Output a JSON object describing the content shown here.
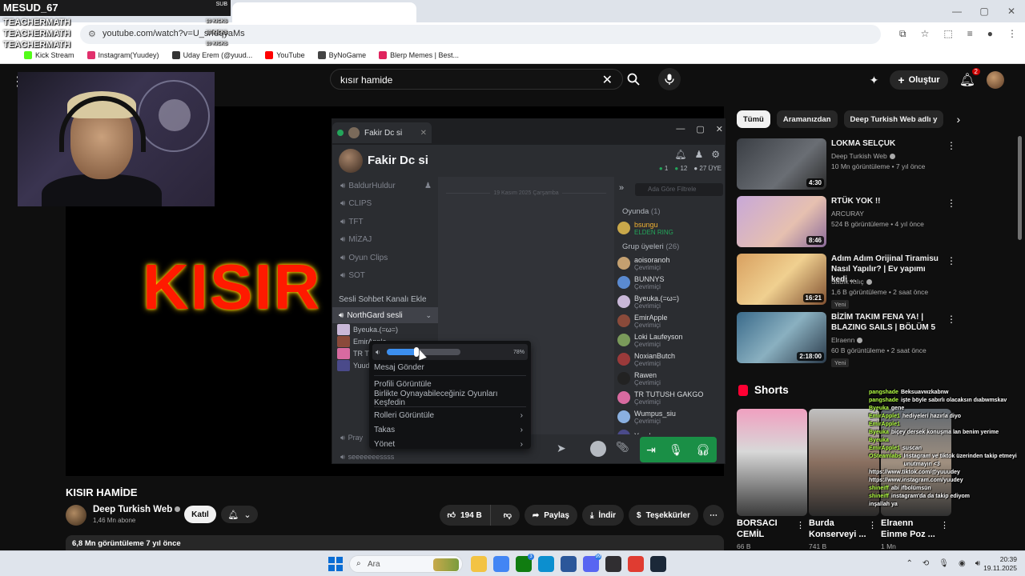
{
  "obs": {
    "username": "MESUD_67",
    "sub_label": "SUB",
    "lines": [
      {
        "text": "TEACHERMATH",
        "small": "10 KICKS"
      },
      {
        "text": "TEACHERMATH",
        "small": "10 KICKS"
      },
      {
        "text": "TEACHERMATH",
        "small": "10 KICKS"
      }
    ]
  },
  "browser": {
    "url": "youtube.com/watch?v=U_srfdqyaMs",
    "bookmarks": [
      {
        "label": "Kick Stream",
        "color": "#53fc18"
      },
      {
        "label": "Instagram(Yuudey)",
        "color": "#e1306c"
      },
      {
        "label": "Uday Erem (@yuud...",
        "color": "#333333"
      },
      {
        "label": "YouTube",
        "color": "#ff0000"
      },
      {
        "label": "ByNoGame",
        "color": "#444444"
      },
      {
        "label": "Blerp Memes | Best...",
        "color": "#e0245e"
      }
    ]
  },
  "youtube": {
    "search_query": "kısır hamide",
    "create_label": "Oluştur",
    "notif_count": "2",
    "video_overlay_text": "KISIR",
    "video_title": "KISIR HAMİDE",
    "channel_name": "Deep Turkish Web",
    "subscribers": "1,46 Mn abone",
    "join_label": "Katıl",
    "likes": "194 B",
    "share_label": "Paylaş",
    "download_label": "İndir",
    "thanks_label": "Teşekkürler",
    "desc_stats": "6,8 Mn görüntüleme  7 yıl önce",
    "chips": [
      "Tümü",
      "Aramanızdan",
      "Deep Turkish Web adlı y"
    ],
    "recommendations": [
      {
        "title": "LOKMA SELÇUK",
        "channel": "Deep Turkish Web",
        "meta": "10 Mn görüntüleme • 7 yıl önce",
        "duration": "4:30",
        "verified": true,
        "badge": ""
      },
      {
        "title": "RTÜK YOK !!",
        "channel": "ARCURAY",
        "meta": "524 B görüntüleme • 4 yıl önce",
        "duration": "8:46",
        "verified": false,
        "badge": ""
      },
      {
        "title": "Adım Adım Orijinal Tiramisu Nasıl Yapılır? | Ev yapımı kedi ...",
        "channel": "Sadık Kılıç",
        "meta": "1,6 B görüntüleme • 2 saat önce",
        "duration": "16:21",
        "verified": true,
        "badge": "Yeni"
      },
      {
        "title": "BİZİM TAKIM FENA YA! | BLAZING SAILS | BÖLÜM 5",
        "channel": "Elraenn",
        "meta": "60 B görüntüleme • 2 saat önce",
        "duration": "2:18:00",
        "verified": true,
        "badge": "Yeni"
      }
    ],
    "shorts_heading": "Shorts",
    "shorts": [
      {
        "title": "BORSACI CEMİL",
        "views": "66 B"
      },
      {
        "title": "Burda Konserveyi ...",
        "views": "741 B"
      },
      {
        "title": "Elraenn Einme Poz ...",
        "views": "1 Mn"
      }
    ]
  },
  "discord": {
    "tab_title": "Fakir Dc si",
    "server_name": "Fakir Dc si",
    "stats": {
      "online": "1",
      "members_online": "12",
      "members": "27 ÜYE"
    },
    "channels": [
      "BaldurHuldur",
      "CLIPS",
      "TFT",
      "MİZAJ",
      "Oyun Clips",
      "SOT"
    ],
    "add_voice_label": "Sesli Sohbet Kanalı Ekle",
    "voice_channel": "NorthGard sesli",
    "voice_users": [
      {
        "name": "Byeuka.(=ω=)",
        "color": "#c9b8d8"
      },
      {
        "name": "EmirApple",
        "color": "#8a4a3a"
      },
      {
        "name": "TR TUTUSH GAKGO",
        "color": "#d86aa0"
      },
      {
        "name": "Yuudey",
        "color": "#4a4a8a"
      }
    ],
    "date_divider": "19 Kasım 2025 Çarşamba",
    "member_search_placeholder": "Ada Göre Filtrele",
    "members_sections": {
      "playing": "Oyunda",
      "playing_count": "(1)",
      "group": "Grup üyeleri",
      "group_count": "(26)"
    },
    "playing_member": {
      "name": "bsungu",
      "game": "ELDEN RING"
    },
    "members": [
      {
        "name": "aoisoranoh",
        "status": "Çevrimiçi",
        "color": "#c4a070"
      },
      {
        "name": "BUNNYS",
        "status": "Çevrimiçi",
        "color": "#5a8ad0"
      },
      {
        "name": "Byeuka.(=ω=)",
        "status": "Çevrimiçi",
        "color": "#c9b8d8"
      },
      {
        "name": "EmirApple",
        "status": "Çevrimiçi",
        "color": "#8a4a3a"
      },
      {
        "name": "Loki Laufeyson",
        "status": "Çevrimiçi",
        "color": "#7a9a5a"
      },
      {
        "name": "NoxianButch",
        "status": "Çevrimiçi",
        "color": "#9a3a3a"
      },
      {
        "name": "Rawen",
        "status": "Çevrimiçi",
        "color": "#222222"
      },
      {
        "name": "TR TUTUSH GAKGO",
        "status": "Çevrimiçi",
        "color": "#d86aa0"
      },
      {
        "name": "Wumpus_siu",
        "status": "Çevrimiçi",
        "color": "#8ab0e0"
      },
      {
        "name": "Yuudey",
        "status": "",
        "color": "#4a4a8a"
      }
    ],
    "bottom_left_1": "Pray",
    "bottom_left_2": "seeeeeeessss",
    "context_menu": {
      "volume_percent": 78,
      "volume_label": "78%",
      "items": [
        {
          "label": "Mesaj Gönder",
          "arrow": false
        },
        {
          "label": "Profili Görüntüle",
          "arrow": false
        },
        {
          "label": "Birlikte Oynayabileceğiniz Oyunları Keşfedin",
          "arrow": false
        },
        {
          "label": "Rolleri Görüntüle",
          "arrow": true
        },
        {
          "label": "Takas",
          "arrow": true
        },
        {
          "label": "Yönet",
          "arrow": true
        }
      ]
    }
  },
  "stream_chat": [
    {
      "user": "pangshade",
      "text": "Beksuavwzkabnw"
    },
    {
      "user": "pangshade",
      "text": "işte böyle sabırlı olacaksın dıabwmskav"
    },
    {
      "user": "Byeuka",
      "text": "gene"
    },
    {
      "user": "EmirApple1",
      "text": "hediyeleri hazırla diyo"
    },
    {
      "user": "EmirApple1",
      "text": ""
    },
    {
      "user": "Byeuka",
      "text": "biçey dersek konuşma lan benim yerime"
    },
    {
      "user": "Byeuka",
      "text": ""
    },
    {
      "user": "EmirApple1",
      "text": "suscan"
    },
    {
      "user": "OSteamlabs",
      "text": "Instagram ve tiktok üzerinden takip etmeyi unutmayın <3"
    },
    {
      "user": "",
      "text": "https://www.tiktok.com/@yuuudey"
    },
    {
      "user": "",
      "text": "https://www.instagram.com/yuudey"
    },
    {
      "user": "shineiff",
      "text": "abi ifbolümsün"
    },
    {
      "user": "shineiff",
      "text": "instagram'da da takip ediyom"
    },
    {
      "user": "",
      "text": "inşallah ya"
    }
  ],
  "taskbar": {
    "search_label": "Ara",
    "time": "20:39",
    "date": "19.11.2025",
    "apps": [
      {
        "name": "file-explorer-icon",
        "color": "#f3c343",
        "badge": ""
      },
      {
        "name": "chrome-icon",
        "color": "#4285f4",
        "badge": ""
      },
      {
        "name": "xbox-icon",
        "color": "#107c10",
        "badge": "3"
      },
      {
        "name": "edge-icon",
        "color": "#0c8fcf",
        "badge": ""
      },
      {
        "name": "store-icon",
        "color": "#2b579a",
        "badge": ""
      },
      {
        "name": "discord-icon",
        "color": "#5865f2",
        "badge": "99"
      },
      {
        "name": "obs-icon",
        "color": "#302e31",
        "badge": ""
      },
      {
        "name": "media-player-icon",
        "color": "#e03c31",
        "badge": ""
      },
      {
        "name": "steam-icon",
        "color": "#1b2838",
        "badge": ""
      }
    ]
  }
}
